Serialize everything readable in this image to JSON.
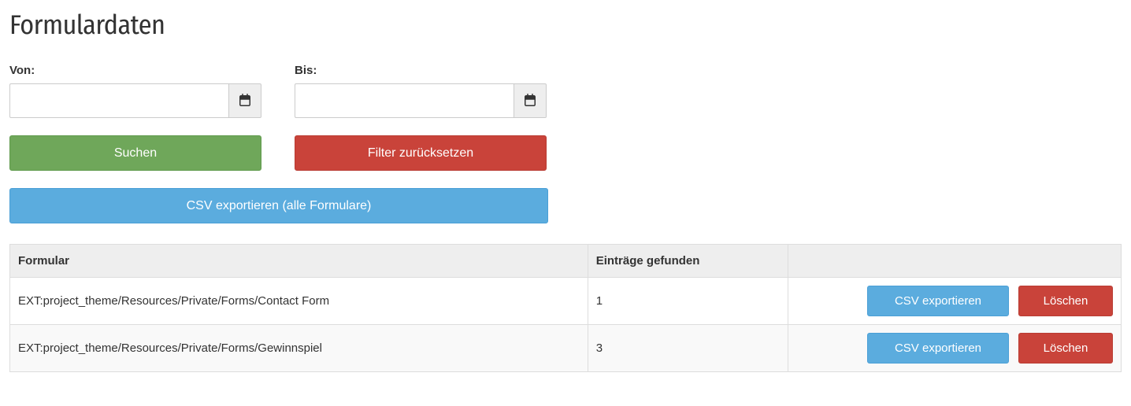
{
  "page": {
    "title": "Formulardaten"
  },
  "filter": {
    "from_label": "Von:",
    "to_label": "Bis:",
    "from_value": "",
    "to_value": "",
    "search_label": "Suchen",
    "reset_label": "Filter zurücksetzen",
    "export_all_label": "CSV exportieren (alle Formulare)"
  },
  "table": {
    "header_form": "Formular",
    "header_count": "Einträge gefunden",
    "row_export_label": "CSV exportieren",
    "row_delete_label": "Löschen",
    "rows": [
      {
        "form": "EXT:project_theme/Resources/Private/Forms/Contact Form",
        "count": "1"
      },
      {
        "form": "EXT:project_theme/Resources/Private/Forms/Gewinnspiel",
        "count": "3"
      }
    ]
  }
}
